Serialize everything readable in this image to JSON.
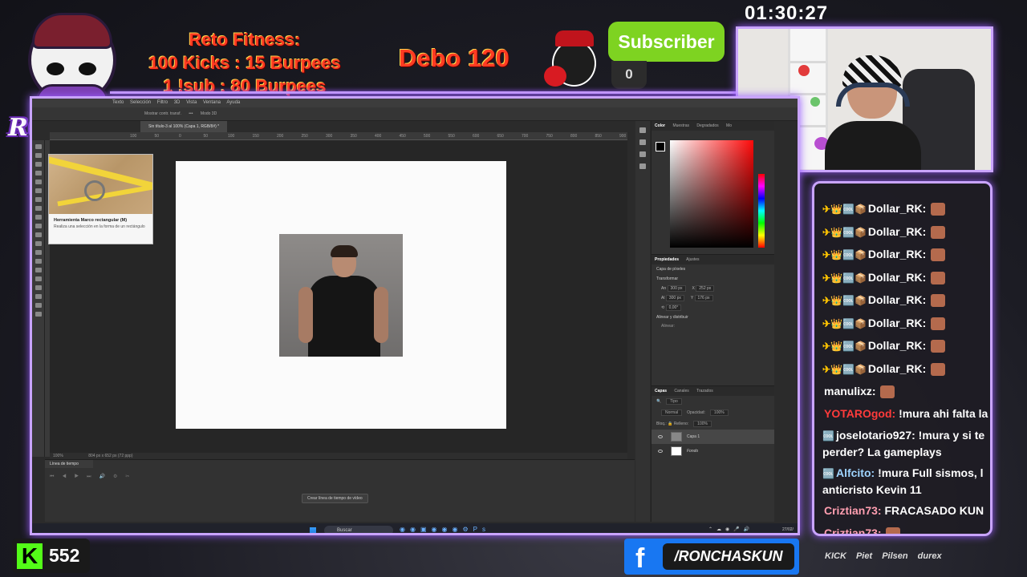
{
  "overlay": {
    "brand": "RONCHAS",
    "challenge_lines": [
      "Reto Fitness:",
      "100 Kicks : 15 Burpees",
      "1 !sub : 80 Burpees"
    ],
    "debo": "Debo 120",
    "subscriber_label": "Subscriber",
    "subscriber_count": "0",
    "timer": "01:30:27"
  },
  "photoshop": {
    "menu": [
      "Texto",
      "Selección",
      "Filtro",
      "3D",
      "Vista",
      "Ventana",
      "Ayuda"
    ],
    "options_bar": [
      "Mostrar contr. transf.",
      "•••",
      "Modo 3D"
    ],
    "doc_tab": "Sin título-3 al 100% (Capa 1, RGB/8#) *",
    "ruler_marks": [
      "100",
      "50",
      "0",
      "50",
      "100",
      "150",
      "200",
      "250",
      "300",
      "350",
      "400",
      "450",
      "500",
      "550",
      "600",
      "650",
      "700",
      "750",
      "800",
      "850",
      "900",
      "950",
      "1000",
      "1050"
    ],
    "tooltip_title": "Herramienta Marco rectangular (M)",
    "tooltip_desc": "Realiza una selección en la forma de un rectángulo",
    "status_zoom": "100%",
    "status_size": "804 px x 652 px (72 ppp)",
    "timeline_title": "Línea de tiempo",
    "timeline_button": "Crear línea de tiempo de vídeo",
    "color_tabs": [
      "Color",
      "Muestras",
      "Degradados",
      "Mo"
    ],
    "props_tabs": [
      "Propiedades",
      "Ajustes"
    ],
    "props_layer_type": "Capa de píxeles",
    "props_transform": "Transformar",
    "props_w": "300 px",
    "props_x": "252 px",
    "props_h": "300 px",
    "props_y": "176 px",
    "props_angle": "0,00°",
    "props_align": "Alinear y distribuir",
    "props_align_sub": "Alinear:",
    "layers_tabs": [
      "Capas",
      "Canales",
      "Trazados"
    ],
    "layers_filter": "Tipo",
    "blend_mode": "Normal",
    "opacity_label": "Opacidad:",
    "opacity": "100%",
    "fill_label": "Relleno:",
    "fill": "100%",
    "lock_label": "Bloq.:",
    "layers": [
      "Capa 1",
      "Fondo"
    ],
    "taskbar_search": "Buscar",
    "taskbar_date": "27/02/"
  },
  "chat": {
    "messages": [
      {
        "user": "Dollar_RK:",
        "badges": "✈👑🆒📦",
        "text": "",
        "color": "#ffffff"
      },
      {
        "user": "Dollar_RK:",
        "badges": "✈👑🆒📦",
        "text": "",
        "color": "#ffffff"
      },
      {
        "user": "Dollar_RK:",
        "badges": "✈👑🆒📦",
        "text": "",
        "color": "#ffffff"
      },
      {
        "user": "Dollar_RK:",
        "badges": "✈👑🆒📦",
        "text": "",
        "color": "#ffffff"
      },
      {
        "user": "Dollar_RK:",
        "badges": "✈👑🆒📦",
        "text": "",
        "color": "#ffffff"
      },
      {
        "user": "Dollar_RK:",
        "badges": "✈👑🆒📦",
        "text": "",
        "color": "#ffffff"
      },
      {
        "user": "Dollar_RK:",
        "badges": "✈👑🆒📦",
        "text": "",
        "color": "#ffffff"
      },
      {
        "user": "Dollar_RK:",
        "badges": "✈👑🆒📦",
        "text": "",
        "color": "#ffffff"
      },
      {
        "user": "manulixz:",
        "badges": "",
        "text": "",
        "color": "#ffffff"
      },
      {
        "user": "YOTAROgod:",
        "badges": "",
        "text": "!mura ahi falta la",
        "color": "#ff3b3b"
      },
      {
        "user": "joselotario927:",
        "badges": "🆒",
        "text": "!mura y si te perder? La gameplays",
        "color": "#ffffff"
      },
      {
        "user": "Alfcito:",
        "badges": "🆒",
        "text": "!mura Full sismos, l anticristo Kevin 11",
        "color": "#9fd4ff"
      },
      {
        "user": "Criztian73:",
        "badges": "",
        "text": "FRACASADO KUN",
        "color": "#ff9eb0"
      },
      {
        "user": "Criztian73:",
        "badges": "",
        "text": "",
        "color": "#ff9eb0"
      }
    ]
  },
  "bottom": {
    "kick_count": "552",
    "facebook_handle": "/RONCHASKUN",
    "sponsors": [
      "KICK",
      "Piet",
      "Pilsen",
      "durex"
    ]
  },
  "colors": {
    "accent_purple": "#c9a4ff",
    "challenge_red": "#ff3b22",
    "subscriber_green": "#7ed321",
    "kick_green": "#53fc18",
    "facebook_blue": "#1877f2"
  }
}
